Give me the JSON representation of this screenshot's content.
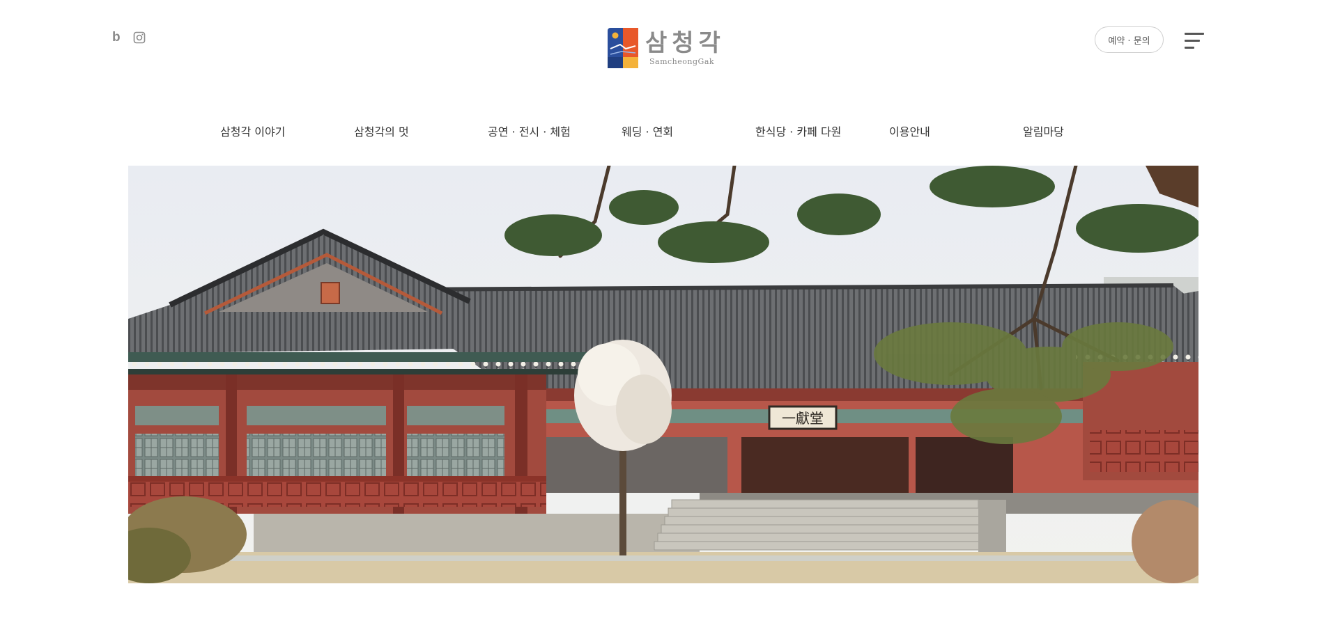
{
  "header": {
    "social": [
      {
        "name": "blog",
        "glyph": "b",
        "icon": "blog-icon"
      },
      {
        "name": "instagram",
        "icon": "instagram-icon"
      }
    ],
    "logo": {
      "korean": "삼청각",
      "english": "SamcheongGak"
    },
    "reserve_label": "예약 · 문의",
    "menu_icon": "hamburger-menu-icon"
  },
  "nav": {
    "items": [
      {
        "label": "삼청각 이야기"
      },
      {
        "label": "삼청각의 멋"
      },
      {
        "label": "공연 · 전시 · 체험"
      },
      {
        "label": "웨딩 · 연회"
      },
      {
        "label": "한식당 · 카페 다원"
      },
      {
        "label": "이용안내"
      },
      {
        "label": "알림마당"
      }
    ]
  },
  "hero": {
    "signboard_text": "一獻堂"
  },
  "colors": {
    "logo_blue": "#2a4e9c",
    "logo_orange": "#e8582a",
    "logo_yellow": "#f4b23a",
    "text_gray": "#8a8a8a"
  }
}
